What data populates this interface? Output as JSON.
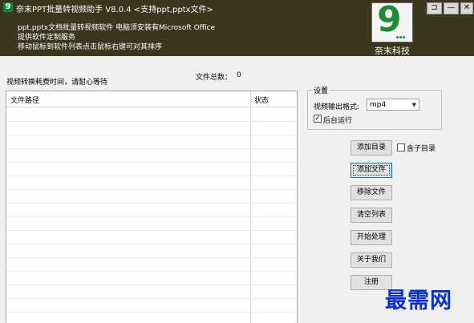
{
  "window": {
    "title": "奈末PPT批量转视频助手   V8.0.4  <支持ppt,pptx文件>",
    "icon_text": "9",
    "controls": {
      "pin": "⊐",
      "minimize": "—",
      "close": "✕"
    }
  },
  "header": {
    "description_lines": [
      "ppt,pptx文档批量转视频软件  电脑须安装有Microsoft Office",
      "提供软件定制服务",
      "移动鼠标到软件列表点击鼠标右键可对其排序"
    ],
    "logo_digit": "9",
    "logo_text": "奈末科技",
    "colors": {
      "header_bg": "#3a371e",
      "logo_green": "#1e8a34"
    }
  },
  "status": {
    "notice": "视频转换耗费时间，请耐心等待",
    "file_count_label": "文件总数：",
    "file_count": "0"
  },
  "table": {
    "columns": [
      "文件路径",
      "状态"
    ],
    "rows": []
  },
  "settings": {
    "group_title": "设置",
    "format_label": "视频输出格式:",
    "format_value": "mp4",
    "background_run_label": "后台运行",
    "background_run_checked": true
  },
  "actions": {
    "add_folder": "添加目录",
    "include_subfolder": "含子目录",
    "include_subfolder_checked": false,
    "add_file": "添加文件",
    "remove_file": "移除文件",
    "clear_list": "清空列表",
    "start": "开始处理",
    "about": "关于我们",
    "register": "注册"
  },
  "watermark": "最需网"
}
